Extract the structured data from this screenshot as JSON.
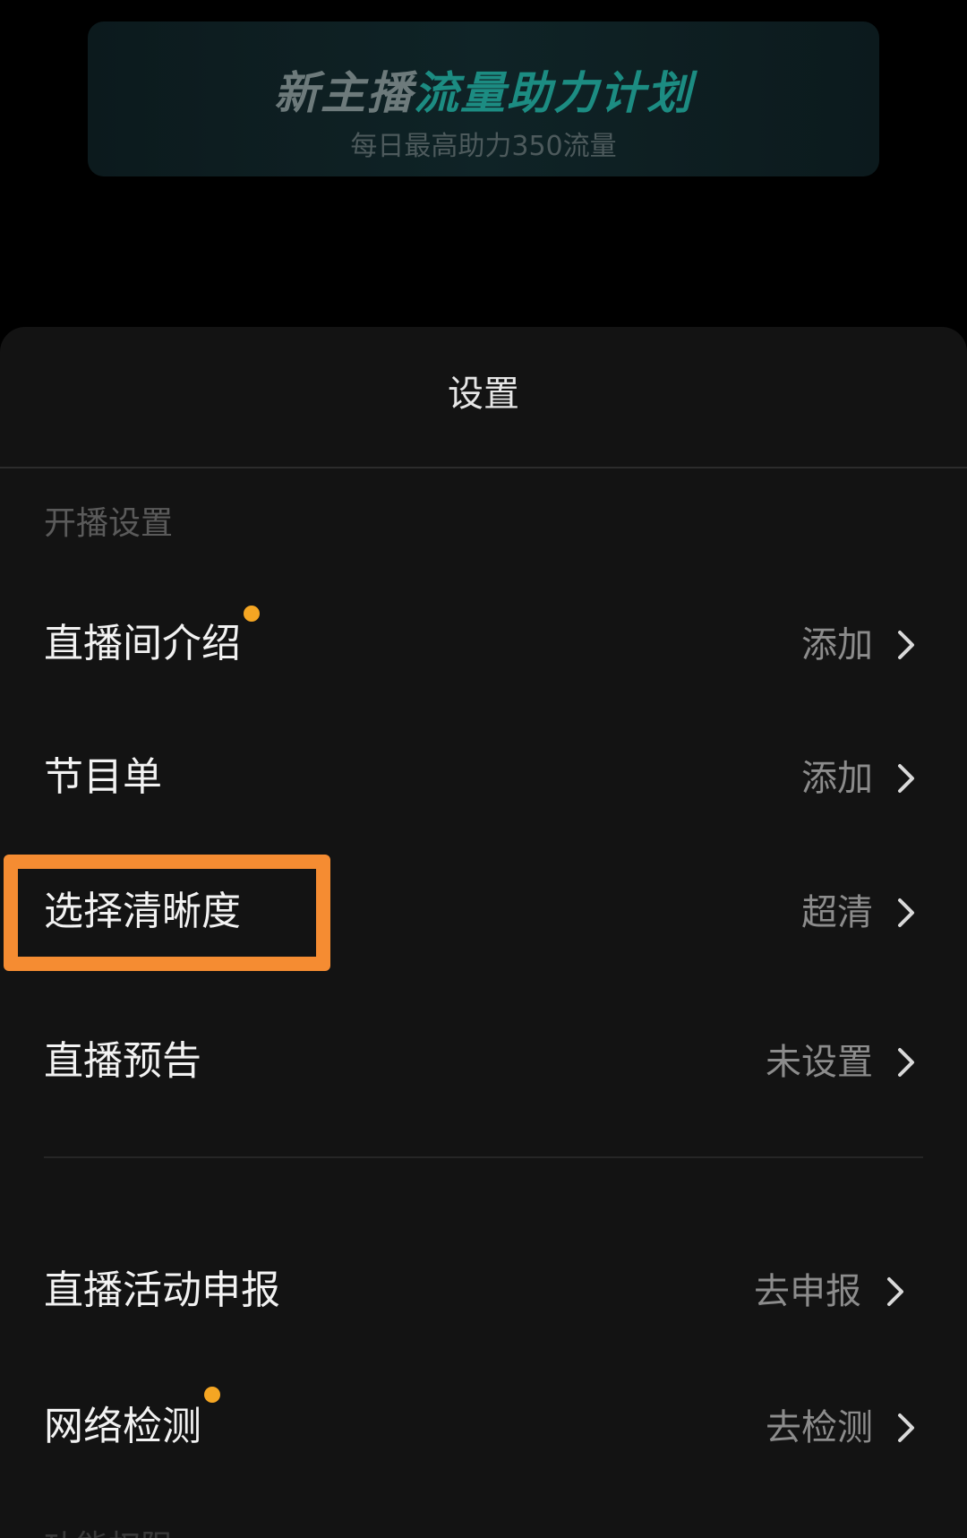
{
  "banner": {
    "title_part1": "新主播",
    "title_part2": "流量助力计划",
    "subtitle": "每日最高助力350流量"
  },
  "sheet": {
    "title": "设置",
    "section_header": "开播设置",
    "rows": [
      {
        "label": "直播间介绍",
        "value": "添加"
      },
      {
        "label": "节目单",
        "value": "添加"
      },
      {
        "label": "选择清晰度",
        "value": "超清"
      },
      {
        "label": "直播预告",
        "value": "未设置"
      },
      {
        "label": "直播活动申报",
        "value": "去申报"
      },
      {
        "label": "网络检测",
        "value": "去检测"
      }
    ],
    "next_section_hint": "功能权限"
  },
  "colors": {
    "accent_dot": "#f5a623",
    "highlight_border": "#f58c32",
    "banner_accent": "#1c8c82"
  },
  "icons": {
    "chevron": "chevron-right-icon",
    "dot": "notification-dot"
  }
}
